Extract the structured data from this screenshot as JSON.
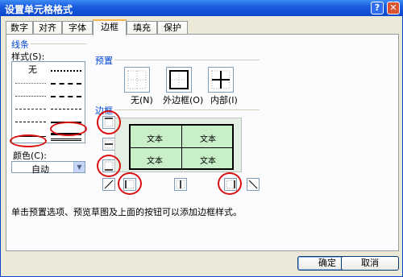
{
  "window": {
    "title": "设置单元格格式",
    "help_glyph": "?",
    "close_glyph": "✕"
  },
  "tabs": [
    {
      "label": "数字"
    },
    {
      "label": "对齐"
    },
    {
      "label": "字体"
    },
    {
      "label": "边框"
    },
    {
      "label": "填充"
    },
    {
      "label": "保护"
    }
  ],
  "line_section": {
    "title": "线条",
    "style_label": "样式(S):",
    "none_label": "无",
    "color_label": "颜色(C):",
    "color_value": "自动"
  },
  "presets": {
    "title": "预置",
    "items": [
      {
        "label": "无(N)"
      },
      {
        "label": "外边框(O)"
      },
      {
        "label": "内部(I)"
      }
    ]
  },
  "border_section": {
    "title": "边框",
    "preview_cells": [
      "文本",
      "文本",
      "文本",
      "文本"
    ]
  },
  "hint": "单击预置选项、预览草图及上面的按钮可以添加边框样式。",
  "buttons": {
    "ok": "确定",
    "cancel": "取消"
  },
  "colors": {
    "accent": "#0a46cc",
    "group_label": "#0046d5",
    "preview_bg": "#c8efc8",
    "annotation_red": "#d91010"
  }
}
